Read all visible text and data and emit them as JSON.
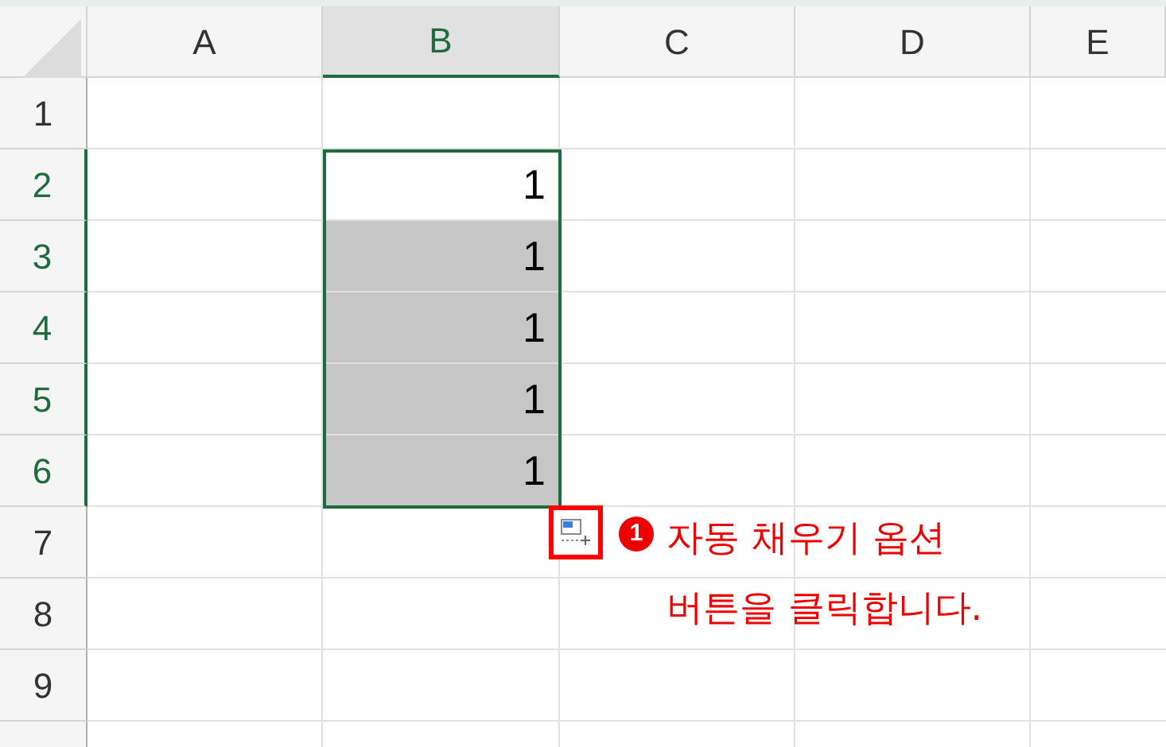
{
  "columns": [
    {
      "label": "A",
      "selected": false
    },
    {
      "label": "B",
      "selected": true
    },
    {
      "label": "C",
      "selected": false
    },
    {
      "label": "D",
      "selected": false
    },
    {
      "label": "E",
      "selected": false
    }
  ],
  "rows": [
    {
      "label": "1",
      "selected": false
    },
    {
      "label": "2",
      "selected": true,
      "value": "1",
      "highlighted": false
    },
    {
      "label": "3",
      "selected": true,
      "value": "1",
      "highlighted": true
    },
    {
      "label": "4",
      "selected": true,
      "value": "1",
      "highlighted": true
    },
    {
      "label": "5",
      "selected": true,
      "value": "1",
      "highlighted": true
    },
    {
      "label": "6",
      "selected": true,
      "value": "1",
      "highlighted": true
    },
    {
      "label": "7",
      "selected": false
    },
    {
      "label": "8",
      "selected": false
    },
    {
      "label": "9",
      "selected": false
    }
  ],
  "annotation": {
    "number": "1",
    "text": "자동 채우기 옵션\n버튼을 클릭합니다."
  }
}
